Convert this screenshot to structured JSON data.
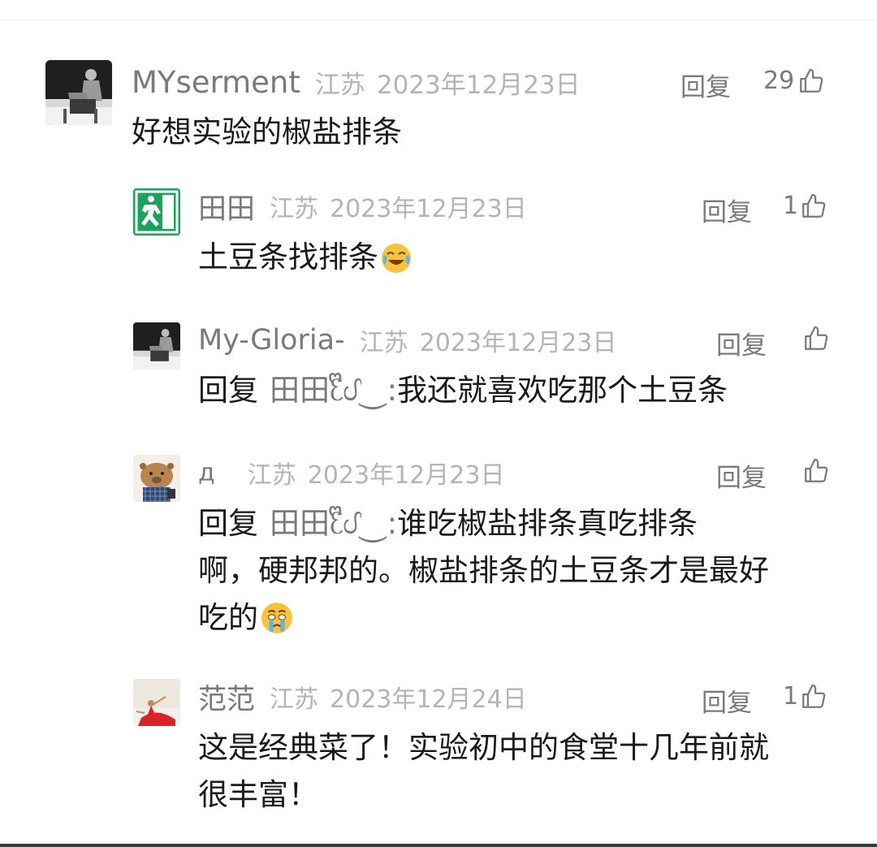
{
  "comments": [
    {
      "name": "MYserment",
      "region": "江苏",
      "time": "2023年12月23日",
      "reply_label": "回复",
      "likes": "29",
      "body": "好想实验的椒盐排条",
      "avatar": "man-in-chair-photo"
    },
    {
      "name": "田田",
      "region": "江苏",
      "time": "2023年12月23日",
      "reply_label": "回复",
      "likes": "1",
      "body": "土豆条找排条",
      "emoji": "laugh-crying-emoji",
      "avatar": "emergency-exit-sign"
    },
    {
      "name": "My-Gloria-",
      "region": "江苏",
      "time": "2023年12月23日",
      "reply_label": "回复",
      "likes": "",
      "reply_prefix": "回复",
      "reply_target": "田田ᦷᩚᦔ⏝:",
      "body": "我还就喜欢吃那个土豆条",
      "avatar": "man-in-chair-photo"
    },
    {
      "name": "д",
      "region": "江苏",
      "time": "2023年12月23日",
      "reply_label": "回复",
      "likes": "",
      "reply_prefix": "回复",
      "reply_target": "田田ᦷᩚᦔ⏝:",
      "body_line1": "谁吃椒盐排条真吃排条",
      "body_line2": "啊，硬邦邦的。椒盐排条的土豆条才是最好",
      "body_line3": "吃的",
      "emoji": "crying-emoji",
      "avatar": "capybara-cartoon"
    },
    {
      "name": "范范",
      "region": "江苏",
      "time": "2023年12月24日",
      "reply_label": "回复",
      "likes": "1",
      "body_line1": "这是经典菜了！实验初中的食堂十几年前就",
      "body_line2": "很丰富！",
      "avatar": "dancer-red-dress-photo"
    }
  ],
  "colors": {
    "name": "#7a7a7a",
    "meta": "#b4b4b4",
    "text": "#1a1a1a"
  }
}
